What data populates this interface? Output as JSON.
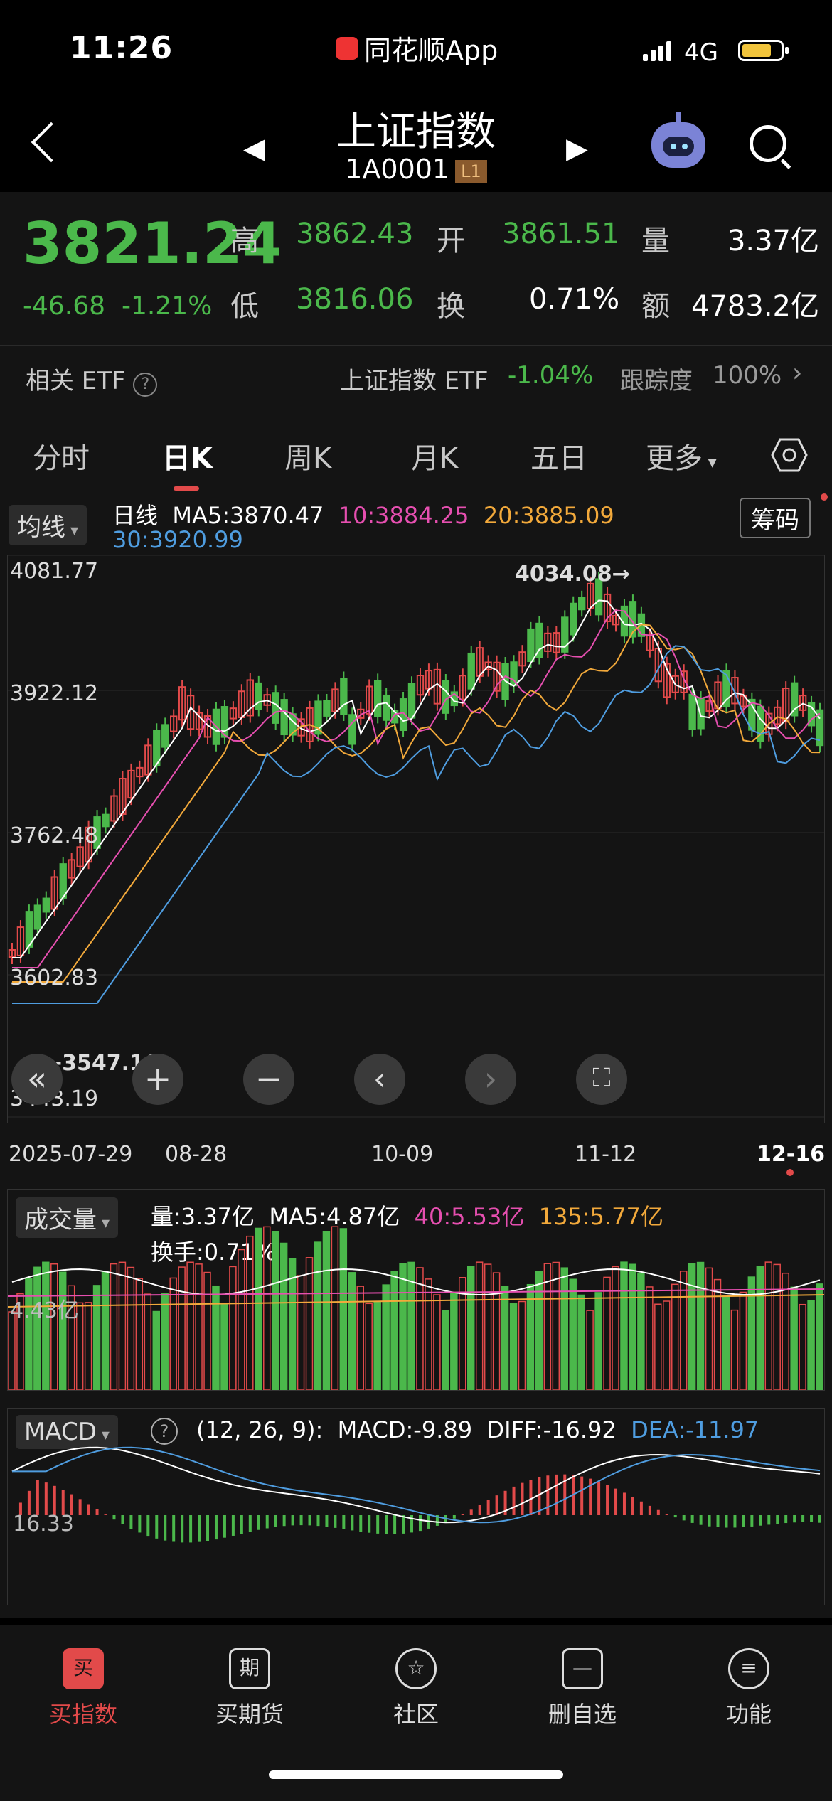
{
  "status": {
    "time": "11:26",
    "app": "同花顺App",
    "carrier": "4G"
  },
  "nav": {
    "title": "上证指数",
    "code": "1A0001",
    "level": "L1"
  },
  "quote": {
    "price": "3821.24",
    "change": "-46.68",
    "change_pct": "-1.21%",
    "labels": {
      "high": "高",
      "open": "开",
      "volume": "量",
      "low": "低",
      "turnover": "换",
      "amount": "额"
    },
    "high": "3862.43",
    "open": "3861.51",
    "volume": "3.37亿",
    "low": "3816.06",
    "turnover": "0.71%",
    "amount": "4783.2亿"
  },
  "etf": {
    "label": "相关 ETF",
    "name": "上证指数 ETF",
    "change": "-1.04%",
    "track_label": "跟踪度",
    "track": "100%"
  },
  "tabs": [
    "分时",
    "日K",
    "周K",
    "月K",
    "五日",
    "更多"
  ],
  "kline": {
    "indicator": "均线",
    "chip_button": "筹码",
    "legend": {
      "period": "日线",
      "ma5": "MA5:3870.47",
      "ma10": "10:3884.25",
      "ma20": "20:3885.09",
      "ma30": "30:3920.99"
    },
    "y_ticks": [
      "4081.77",
      "3922.12",
      "3762.48",
      "3602.83",
      "3443.19"
    ],
    "max_marker": "4034.08→",
    "min_marker": "←3547.16",
    "x_ticks": [
      "2025-07-29",
      "08-28",
      "10-09",
      "11-12",
      "12-16"
    ]
  },
  "volume": {
    "indicator": "成交量",
    "vol": "量:3.37亿",
    "ma5": "MA5:4.87亿",
    "ma40": "40:5.53亿",
    "ma135": "135:5.77亿",
    "turnover": "换手:0.71%",
    "y_tick": "4.43亿"
  },
  "macd": {
    "indicator": "MACD",
    "params": "(12, 26, 9):",
    "macd": "MACD:-9.89",
    "diff": "DIFF:-16.92",
    "dea": "DEA:-11.97",
    "y_tick": "16.33"
  },
  "bottom_nav": [
    {
      "label": "买指数",
      "icon": "买"
    },
    {
      "label": "买期货",
      "icon": "期"
    },
    {
      "label": "社区",
      "icon": "☆"
    },
    {
      "label": "删自选",
      "icon": "—"
    },
    {
      "label": "功能",
      "icon": "≡"
    }
  ],
  "colors": {
    "up": "#e24a4a",
    "down": "#4bb84b",
    "ma5": "#ffffff",
    "ma10": "#e64fb0",
    "ma20": "#f2a93b",
    "ma30": "#4f9de0"
  }
}
